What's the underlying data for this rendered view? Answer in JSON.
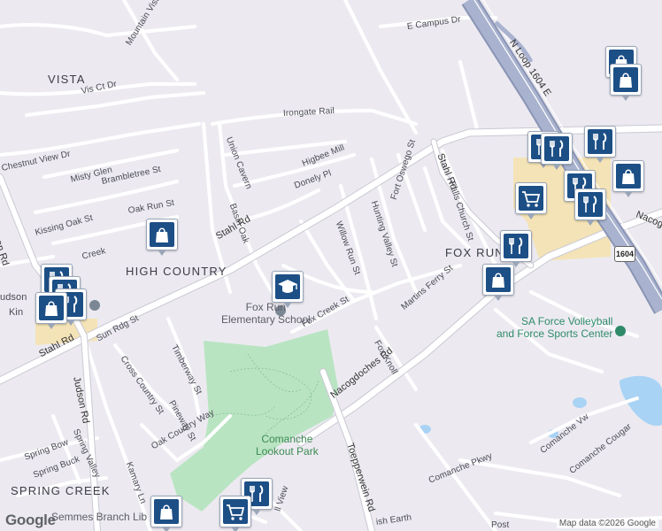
{
  "map": {
    "attribution": "Map data ©2026 Google",
    "logo": "Google",
    "highway_shield": "1604",
    "colors": {
      "background": "#eceaf0",
      "road": "#ffffff",
      "road_edge": "#c9c9d3",
      "highway": "#9aa5c2",
      "park": "#b9e4c2",
      "water": "#a9d3f5",
      "commercial": "#f4e3b7",
      "marker": "#1c4f86"
    }
  },
  "areas": {
    "vista": "VISTA",
    "high_country": "HIGH COUNTRY",
    "fox_run": "FOX RUN",
    "spring_creek": "SPRING CREEK"
  },
  "streets": {
    "mountain_vista": "Mountain Vista",
    "e_campus_dr": "E Campus Dr",
    "n_loop_1604_e": "N Loop 1604 E",
    "vis_ct_dr": "Vis Ct Dr",
    "irongate_rail": "Irongate Rail",
    "chestnut_view_dr": "Chestnut View Dr",
    "misty_glen": "Misty Glen",
    "union_cavern": "Union Cavern",
    "higbee_mill": "Higbee Mill",
    "brambletree_st": "Brambletree St",
    "stahl_rd_1": "Stahl Rd",
    "stahl_rd_2": "Stahl Rd",
    "stahl_rd_3": "Stahl Rd",
    "falls_church_st": "Falls Church St",
    "hunting_valley_st": "Hunting Valley St",
    "fort_oswego_st": "Fort Oswego St",
    "nacogdoches_edge": "Nacog",
    "judson_rd_1": "Judson Rd",
    "judson_rd_2": "Judson Rd",
    "kissing_oak_st": "Kissing Oak St",
    "oak_run_st": "Oak Run St",
    "basin_oak": "Basin Oak",
    "donely_pl": "Donely Pl",
    "willow_run_st": "Willow Run St",
    "creek_fragment": "Creek",
    "judson_fragment": "udson",
    "kin_fragment": "Kin",
    "martins_ferry_st": "Martins Ferry St",
    "sun_rdg_st": "Sun Rdg St",
    "fox_creek_st": "Fox Creek St",
    "cross_country_st": "Cross Country St",
    "timberway_st": "Timberway St",
    "fox_knoll": "Fox Knoll",
    "nacogdoches_rd": "Nacogdoches Rd",
    "pineway_st": "Pineway St",
    "spring_bow": "Spring Bow",
    "spring_valley": "Spring Valley",
    "spring_buck": "Spring Buck",
    "kamary_ln": "Kamary Ln",
    "oak_country_way": "Oak Country Way",
    "toepperwein_rd": "Toepperwein Rd",
    "comanche_vw": "Comanche Vw",
    "comanche_cougar": "Comanche Cougar",
    "comanche_pkwy": "Comanche Pkwy",
    "ish_earth": "ish Earth",
    "ll_view": "ll View",
    "post_fragment": "Post"
  },
  "pois": {
    "school": "Fox Run\nElementary School",
    "park": "Comanche\nLookout Park",
    "volleyball": "SA Force Volleyball\nand Force Sports Center",
    "library": "Semmes Branch Lib"
  },
  "markers": {
    "shopping_bag": "shopping-bag-icon",
    "restaurant": "restaurant-icon",
    "grocery": "grocery-cart-icon",
    "school": "school-icon"
  }
}
